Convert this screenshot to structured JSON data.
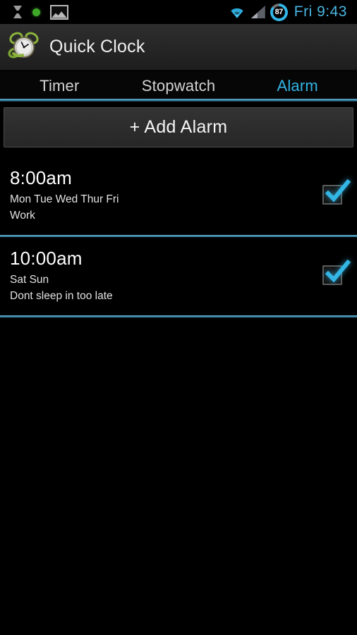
{
  "statusbar": {
    "icons_left": [
      "hourglass-icon",
      "green-dot-icon",
      "picture-icon"
    ],
    "icons_right": [
      "wifi-icon",
      "signal-icon",
      "battery-icon"
    ],
    "battery_percent": "87",
    "clock": "Fri  9:43",
    "accent": "#33b5e5"
  },
  "titlebar": {
    "icon": "alarm-clock-icon",
    "title": "Quick Clock"
  },
  "tabs": [
    {
      "label": "Timer",
      "active": false
    },
    {
      "label": "Stopwatch",
      "active": false
    },
    {
      "label": "Alarm",
      "active": true
    }
  ],
  "actions": {
    "add_alarm_label": "+ Add Alarm"
  },
  "alarms": [
    {
      "time": "8:00am",
      "days": "Mon Tue Wed Thur Fri",
      "label": "Work",
      "enabled": true
    },
    {
      "time": "10:00am",
      "days": "Sat Sun",
      "label": "Dont sleep in too late",
      "enabled": true
    }
  ],
  "colors": {
    "accent_blue": "#33b5e5",
    "divider_blue": "#3a7fa0",
    "background": "#000000",
    "titlebar": "#262626",
    "button": "#2c2c2c"
  }
}
